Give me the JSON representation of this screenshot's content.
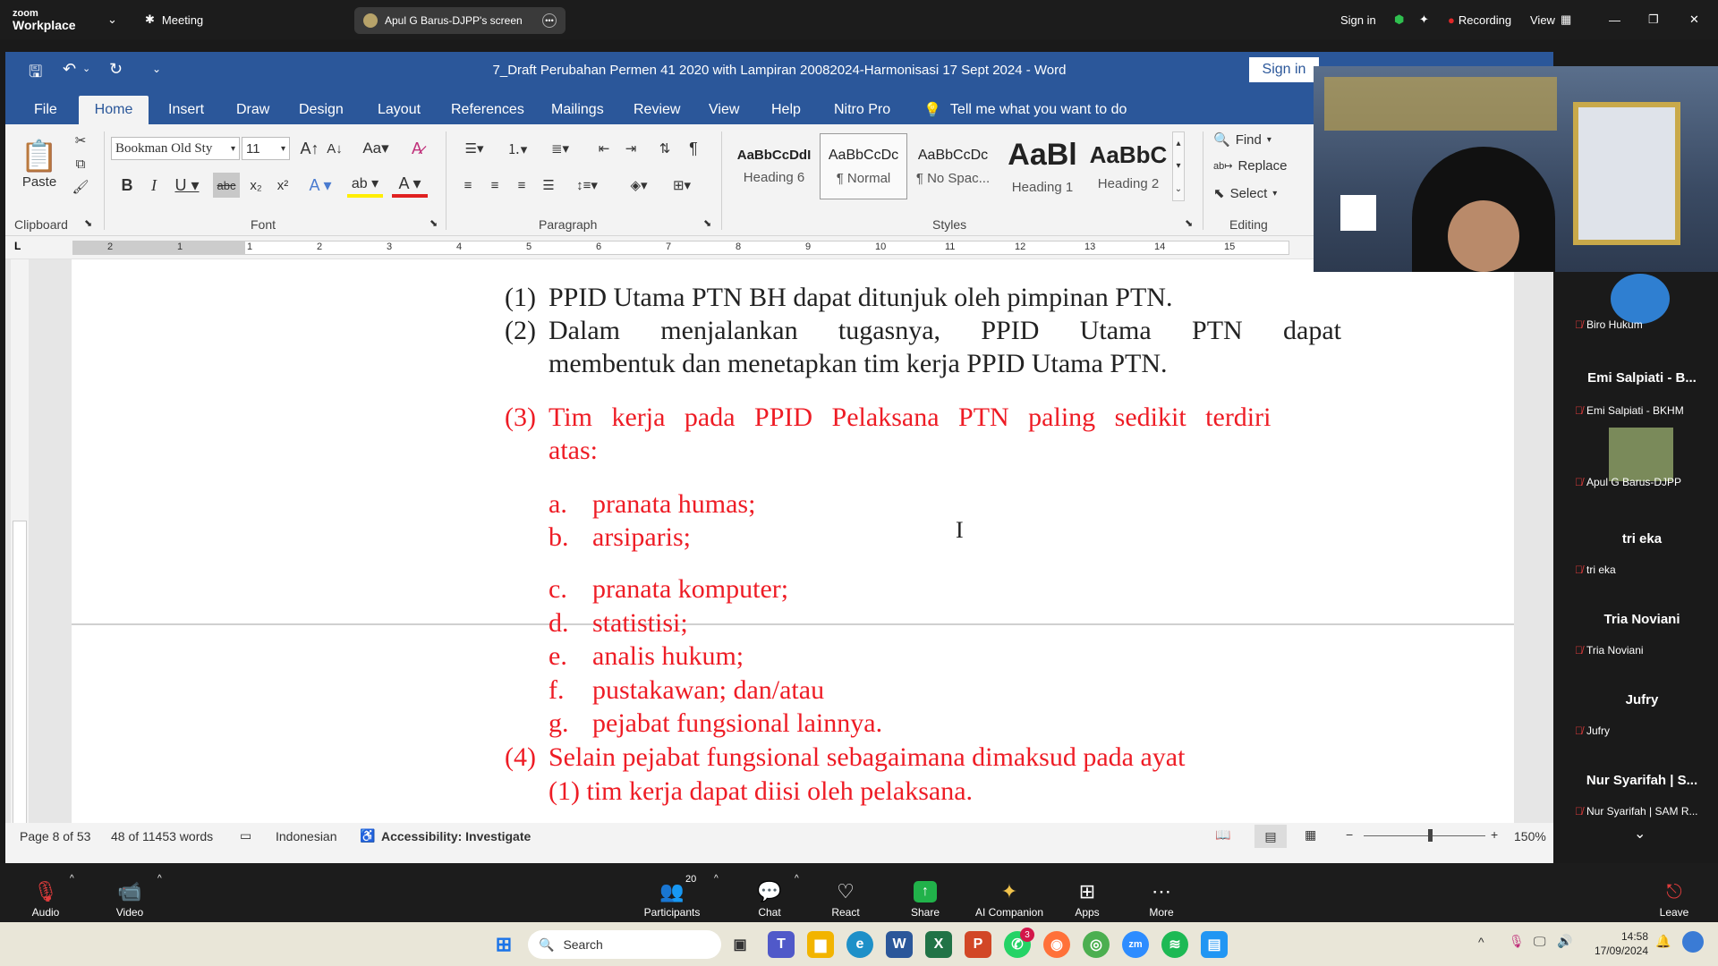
{
  "zoom_top": {
    "brand_line1": "zoom",
    "brand_line2": "Workplace",
    "meeting_label": "Meeting",
    "share_label": "Apul G Barus-DJPP's screen",
    "sign_in": "Sign in",
    "recording": "Recording",
    "view": "View"
  },
  "word": {
    "title": "7_Draft Perubahan Permen 41 2020 with Lampiran 20082024-Harmonisasi 17 Sept 2024  -  Word",
    "sign_in": "Sign in",
    "tabs": [
      "File",
      "Home",
      "Insert",
      "Draw",
      "Design",
      "Layout",
      "References",
      "Mailings",
      "Review",
      "View",
      "Help",
      "Nitro Pro"
    ],
    "tell_me": "Tell me what you want to do",
    "clipboard": {
      "paste": "Paste",
      "label": "Clipboard"
    },
    "font": {
      "name": "Bookman Old Sty",
      "size": "11",
      "label": "Font"
    },
    "paragraph_label": "Paragraph",
    "styles": [
      {
        "sample": "AaBbCcDdI",
        "name": "Heading 6"
      },
      {
        "sample": "AaBbCcDc",
        "name": "¶ Normal"
      },
      {
        "sample": "AaBbCcDc",
        "name": "¶ No Spac..."
      },
      {
        "sample": "AaBl",
        "name": "Heading 1"
      },
      {
        "sample": "AaBbC",
        "name": "Heading 2"
      }
    ],
    "styles_label": "Styles",
    "editing": {
      "find": "Find",
      "replace": "Replace",
      "select": "Select",
      "label": "Editing"
    },
    "ruler_numbers": [
      "2",
      "1",
      "1",
      "2",
      "3",
      "4",
      "5",
      "6",
      "7",
      "8",
      "9",
      "10",
      "11",
      "12",
      "13",
      "14",
      "15"
    ],
    "doc_lines": {
      "l1_num": "(1)",
      "l1_text": "PPID Utama PTN BH dapat ditunjuk oleh pimpinan PTN.",
      "l2_num": "(2)",
      "l2_text": "Dalam menjalankan tugasnya, PPID Utama PTN dapat",
      "l2b_text": "membentuk dan menetapkan tim kerja PPID Utama PTN.",
      "l3_num": "(3)",
      "l3_text": "Tim kerja pada PPID Pelaksana PTN paling sedikit terdiri",
      "l3b_text": "atas:",
      "items": [
        {
          "letter": "a.",
          "text": "pranata humas;"
        },
        {
          "letter": "b.",
          "text": "arsiparis;"
        },
        {
          "letter": "c.",
          "text": "pranata komputer;"
        },
        {
          "letter": "d.",
          "text": "statistisi;"
        },
        {
          "letter": "e.",
          "text": "analis hukum;"
        },
        {
          "letter": "f.",
          "text": "pustakawan; dan/atau"
        },
        {
          "letter": "g.",
          "text": "pejabat fungsional lainnya."
        }
      ],
      "l4_num": "(4)",
      "l4_text": "Selain pejabat fungsional sebagaimana dimaksud pada ayat",
      "l4b_text": "(1) tim kerja dapat diisi oleh pelaksana."
    },
    "status": {
      "page": "Page 8 of 53",
      "words": "48 of 11453 words",
      "language": "Indonesian",
      "accessibility": "Accessibility: Investigate",
      "zoom": "150%"
    }
  },
  "participants": [
    {
      "name_big": "",
      "name_small": "Biro Hukum",
      "has_avatar": true
    },
    {
      "name_big": "Emi Salpiati - B...",
      "name_small": "Emi Salpiati - BKHM"
    },
    {
      "name_big": "",
      "name_small": "Apul G Barus-DJPP",
      "has_avatar": true
    },
    {
      "name_big": "tri eka",
      "name_small": "tri eka"
    },
    {
      "name_big": "Tria Noviani",
      "name_small": "Tria Noviani"
    },
    {
      "name_big": "Jufry",
      "name_small": "Jufry"
    },
    {
      "name_big": "Nur Syarifah | S...",
      "name_small": "Nur Syarifah | SAM R..."
    }
  ],
  "zoom_bottom": {
    "audio": "Audio",
    "video": "Video",
    "participants": "Participants",
    "participants_count": "20",
    "chat": "Chat",
    "react": "React",
    "share": "Share",
    "ai": "AI Companion",
    "apps": "Apps",
    "more": "More",
    "leave": "Leave"
  },
  "taskbar": {
    "search": "Search",
    "time": "14:58",
    "date": "17/09/2024",
    "whatsapp_badge": "3"
  },
  "colors": {
    "word_blue": "#2b579a",
    "doc_red": "#ee1c25",
    "zoom_dark": "#1c1c1c"
  }
}
